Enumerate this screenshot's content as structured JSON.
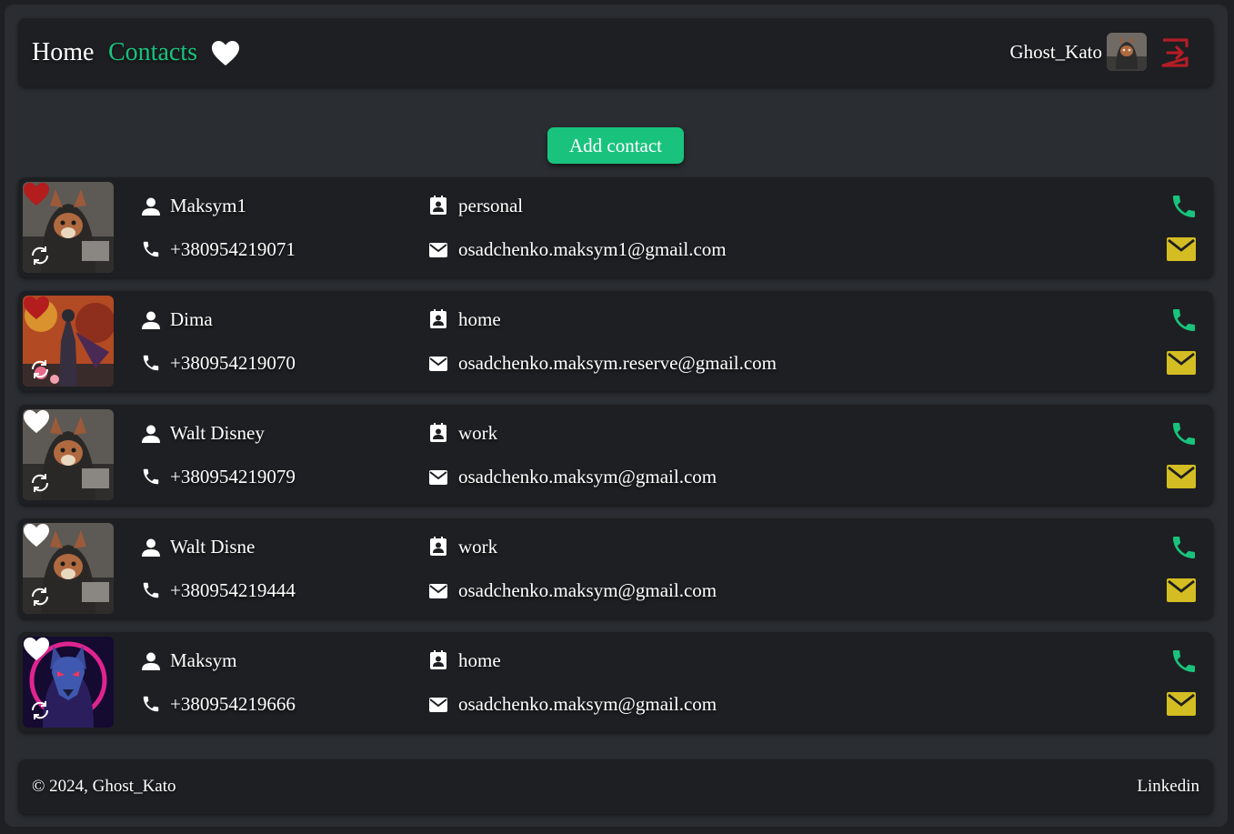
{
  "header": {
    "home_label": "Home",
    "contacts_label": "Contacts",
    "favorites_icon": "heart-icon",
    "username": "Ghost_Kato",
    "logout_icon": "logout-icon"
  },
  "add_contact_label": "Add contact",
  "colors": {
    "accent_green": "#19c37d",
    "mail_yellow": "#d4bd22",
    "favorite_red": "#b31d1d",
    "logout_red": "#b31d26"
  },
  "contacts": [
    {
      "name": "Maksym1",
      "phone": "+380954219071",
      "category": "personal",
      "email": "osadchenko.maksym1@gmail.com",
      "favorite": true
    },
    {
      "name": "Dima",
      "phone": "+380954219070",
      "category": "home",
      "email": "osadchenko.maksym.reserve@gmail.com",
      "favorite": true
    },
    {
      "name": "Walt Disney",
      "phone": "+380954219079",
      "category": "work",
      "email": "osadchenko.maksym@gmail.com",
      "favorite": false
    },
    {
      "name": "Walt Disne",
      "phone": "+380954219444",
      "category": "work",
      "email": "osadchenko.maksym@gmail.com",
      "favorite": false
    },
    {
      "name": "Maksym",
      "phone": "+380954219666",
      "category": "home",
      "email": "osadchenko.maksym@gmail.com",
      "favorite": false
    }
  ],
  "footer": {
    "copyright": "© 2024, Ghost_Kato",
    "linkedin_label": "Linkedin"
  }
}
